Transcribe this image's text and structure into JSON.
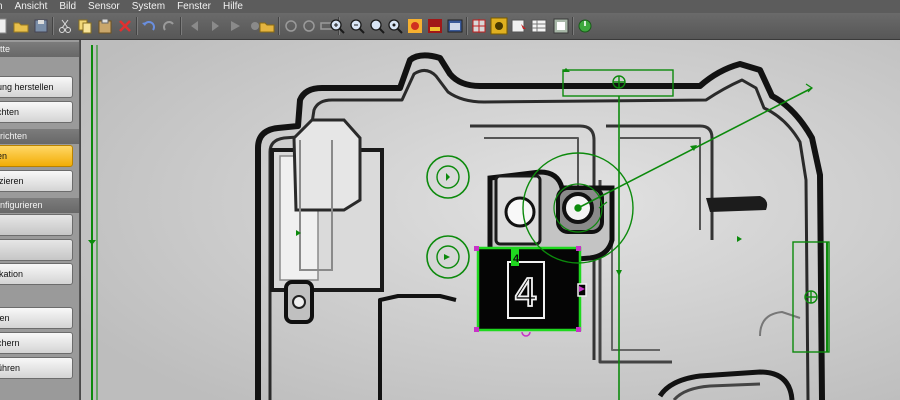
{
  "menu": [
    "n",
    "Ansicht",
    "Bild",
    "Sensor",
    "System",
    "Fenster",
    "Hilfe"
  ],
  "toolbar_icons": [
    "new-doc-icon",
    "open-folder-icon",
    "save-icon",
    "cut-icon",
    "copy-icon",
    "paste-icon",
    "delete-icon",
    "undo-icon",
    "redo-icon",
    "step-back-icon",
    "step-forward-icon",
    "play-icon",
    "stop-icon",
    "record-icon",
    "folder-image-icon",
    "circle-tool-icon",
    "circle-tool-2-icon",
    "rect-tool-icon",
    "zoom-in-icon",
    "zoom-out-icon",
    "zoom-fit-icon",
    "zoom-100-icon",
    "color-palette-icon",
    "image-color-icon",
    "window-icon",
    "crosshair-icon",
    "sun-icon",
    "binary-icon",
    "table-icon",
    "settings-icon",
    "power-icon"
  ],
  "sidebar": {
    "header1": "ritte",
    "header2": "nrichten",
    "header3": "onfigurieren",
    "buttons": [
      {
        "label": "ung herstellen",
        "state": "normal"
      },
      {
        "label": "chten",
        "state": "normal"
      },
      {
        "label": "en",
        "state": "active"
      },
      {
        "label": "izieren",
        "state": "normal"
      },
      {
        "label": "",
        "state": "disabled"
      },
      {
        "label": "",
        "state": "disabled"
      },
      {
        "label": "ikation",
        "state": "normal"
      },
      {
        "label": "fen",
        "state": "normal"
      },
      {
        "label": "chern",
        "state": "normal"
      },
      {
        "label": "ühren",
        "state": "normal"
      }
    ]
  },
  "viewer": {
    "digit": "4",
    "digit_small": "4",
    "overlay_color": "#0c8a0c",
    "highlight_color": "#1fd81f",
    "handle_color": "#c832c8"
  }
}
